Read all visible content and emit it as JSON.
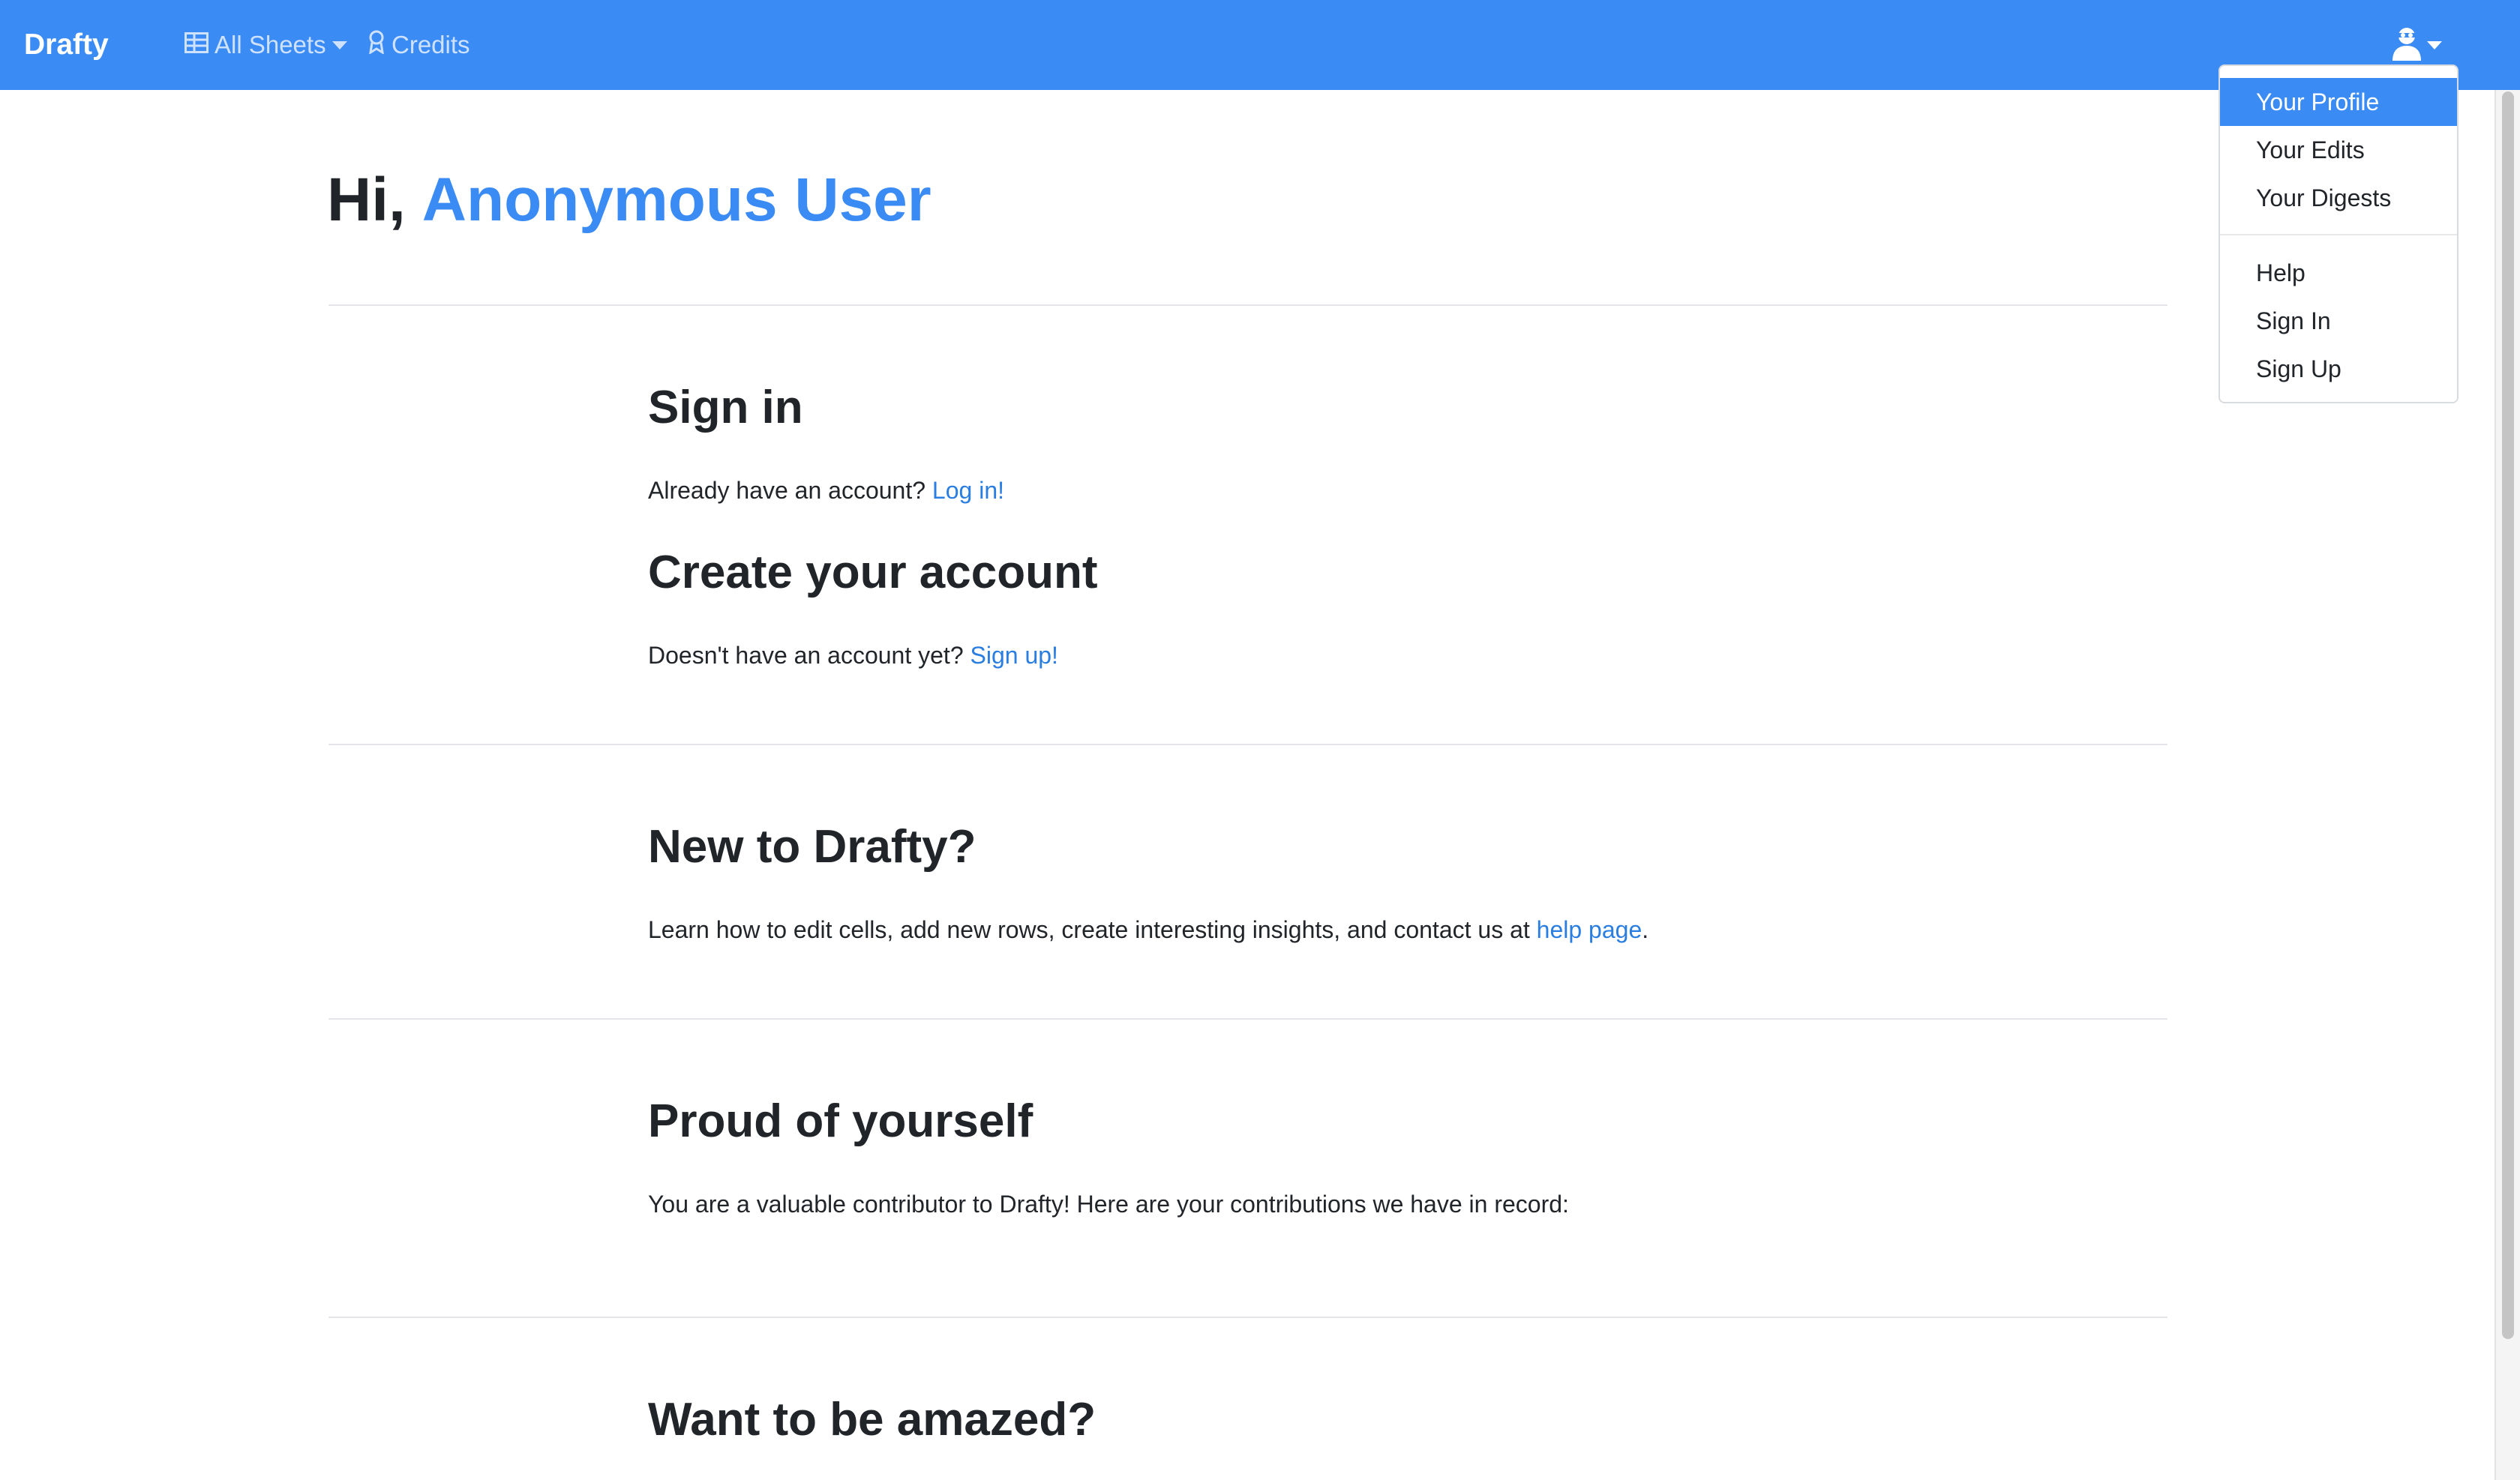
{
  "navbar": {
    "brand": "Drafty",
    "all_sheets_label": "All Sheets",
    "credits_label": "Credits"
  },
  "user_menu": {
    "items": [
      {
        "label": "Your Profile",
        "active": true
      },
      {
        "label": "Your Edits"
      },
      {
        "label": "Your Digests"
      },
      {
        "label": "Help"
      },
      {
        "label": "Sign In"
      },
      {
        "label": "Sign Up"
      }
    ]
  },
  "greeting": {
    "prefix": "Hi,",
    "name": "Anonymous User"
  },
  "sections": {
    "sign_in": {
      "heading": "Sign in",
      "text": "Already have an account?",
      "link": "Log in!"
    },
    "create_account": {
      "heading": "Create your account",
      "text": "Doesn't have an account yet?",
      "link": "Sign up!"
    },
    "new_to_drafty": {
      "heading": "New to Drafty?",
      "text": "Learn how to edit cells, add new rows, create interesting insights, and contact us at",
      "link": "help page",
      "suffix": "."
    },
    "proud": {
      "heading": "Proud of yourself",
      "text": "You are a valuable contributor to Drafty! Here are your contributions we have in record:"
    },
    "amazed": {
      "heading": "Want to be amazed?"
    }
  },
  "colors": {
    "navbar": "#3b8bf5",
    "accent": "#3b8bf5",
    "link": "#2a7de1"
  }
}
